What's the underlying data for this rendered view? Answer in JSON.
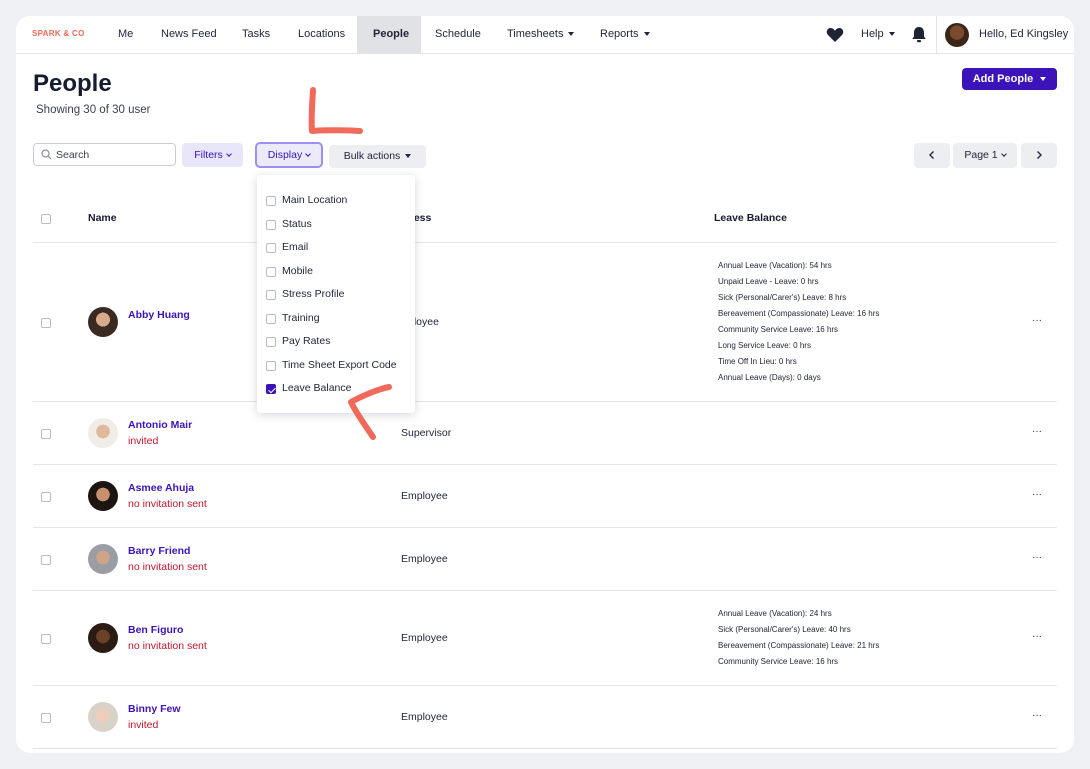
{
  "brand": {
    "logo": "SPARK & CO",
    "accent": "#3b13b8",
    "annotation_color": "#f0695a",
    "status_red": "#c0162b"
  },
  "nav": {
    "items": [
      {
        "label": "Me"
      },
      {
        "label": "News Feed"
      },
      {
        "label": "Tasks"
      },
      {
        "label": "Locations"
      },
      {
        "label": "People",
        "active": true
      },
      {
        "label": "Schedule"
      },
      {
        "label": "Timesheets",
        "dropdown": true
      },
      {
        "label": "Reports",
        "dropdown": true
      }
    ],
    "help": "Help",
    "icons": [
      "heart-icon",
      "bell-icon"
    ],
    "greeting": "Hello, Ed Kingsley"
  },
  "header": {
    "title": "People",
    "subtitle": "Showing 30 of 30 user",
    "add_button": "Add People"
  },
  "toolbar": {
    "search_placeholder": "Search",
    "filters": "Filters",
    "display": "Display",
    "bulk_actions": "Bulk actions",
    "page": "Page 1",
    "prev_icon": "chevron-left-icon",
    "next_icon": "chevron-right-icon"
  },
  "display_menu": {
    "options": [
      {
        "label": "Main Location",
        "checked": false
      },
      {
        "label": "Status",
        "checked": false
      },
      {
        "label": "Email",
        "checked": false
      },
      {
        "label": "Mobile",
        "checked": false
      },
      {
        "label": "Stress Profile",
        "checked": false
      },
      {
        "label": "Training",
        "checked": false
      },
      {
        "label": "Pay Rates",
        "checked": false
      },
      {
        "label": "Time Sheet Export Code",
        "checked": false
      },
      {
        "label": "Leave Balance",
        "checked": true
      }
    ]
  },
  "table": {
    "columns": {
      "name": "Name",
      "access": "Access",
      "access_visible": "cess",
      "leave_balance": "Leave Balance"
    },
    "rows": [
      {
        "name": "Abby Huang",
        "status": "",
        "access": "Employee",
        "access_visible": "ployee",
        "leave": [
          "Annual Leave (Vacation): 54 hrs",
          "Unpaid Leave - Leave: 0 hrs",
          "Sick (Personal/Carer's) Leave: 8 hrs",
          "Bereavement (Compassionate) Leave: 16 hrs",
          "Community Service Leave: 16 hrs",
          "Long Service Leave: 0 hrs",
          "Time Off In Lieu: 0 hrs",
          "Annual Leave (Days): 0 days"
        ]
      },
      {
        "name": "Antonio Mair",
        "status": "invited",
        "access": "Supervisor",
        "leave": []
      },
      {
        "name": "Asmee Ahuja",
        "status": "no invitation sent",
        "access": "Employee",
        "leave": []
      },
      {
        "name": "Barry Friend",
        "status": "no invitation sent",
        "access": "Employee",
        "leave": []
      },
      {
        "name": "Ben Figuro",
        "status": "no invitation sent",
        "access": "Employee",
        "leave": [
          "Annual Leave (Vacation): 24 hrs",
          "Sick (Personal/Carer's) Leave: 40 hrs",
          "Bereavement (Compassionate) Leave: 21 hrs",
          "Community Service Leave: 16 hrs"
        ]
      },
      {
        "name": "Binny Few",
        "status": "invited",
        "access": "Employee",
        "leave": []
      }
    ],
    "row_menu": "···"
  }
}
